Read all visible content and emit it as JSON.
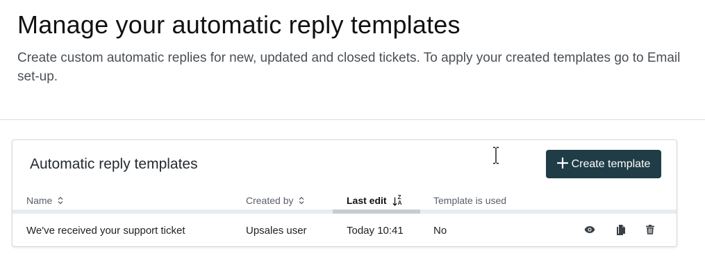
{
  "page": {
    "title": "Manage your automatic reply templates",
    "description": "Create custom automatic replies for new, updated and closed tickets. To apply your created templates go to Email set-up."
  },
  "card": {
    "title": "Automatic reply templates",
    "create_button_label": "Create template",
    "create_button_icon": "plus-icon",
    "accent_color": "#203c46"
  },
  "table": {
    "columns": [
      {
        "label": "Name",
        "sort_icon": "sort-icon"
      },
      {
        "label": "Created by",
        "sort_icon": "sort-icon"
      },
      {
        "label": "Last edit",
        "sort_icon": "sort-z-a-icon",
        "active": true
      },
      {
        "label": "Template is used"
      }
    ],
    "rows": [
      {
        "name": "We've received your support ticket",
        "created_by": "Upsales user",
        "last_edit": "Today 10:41",
        "used": "No",
        "actions": [
          "eye-icon",
          "copy-icon",
          "trash-icon"
        ]
      }
    ]
  },
  "sort_letters": {
    "top": "Z",
    "bottom": "A"
  }
}
